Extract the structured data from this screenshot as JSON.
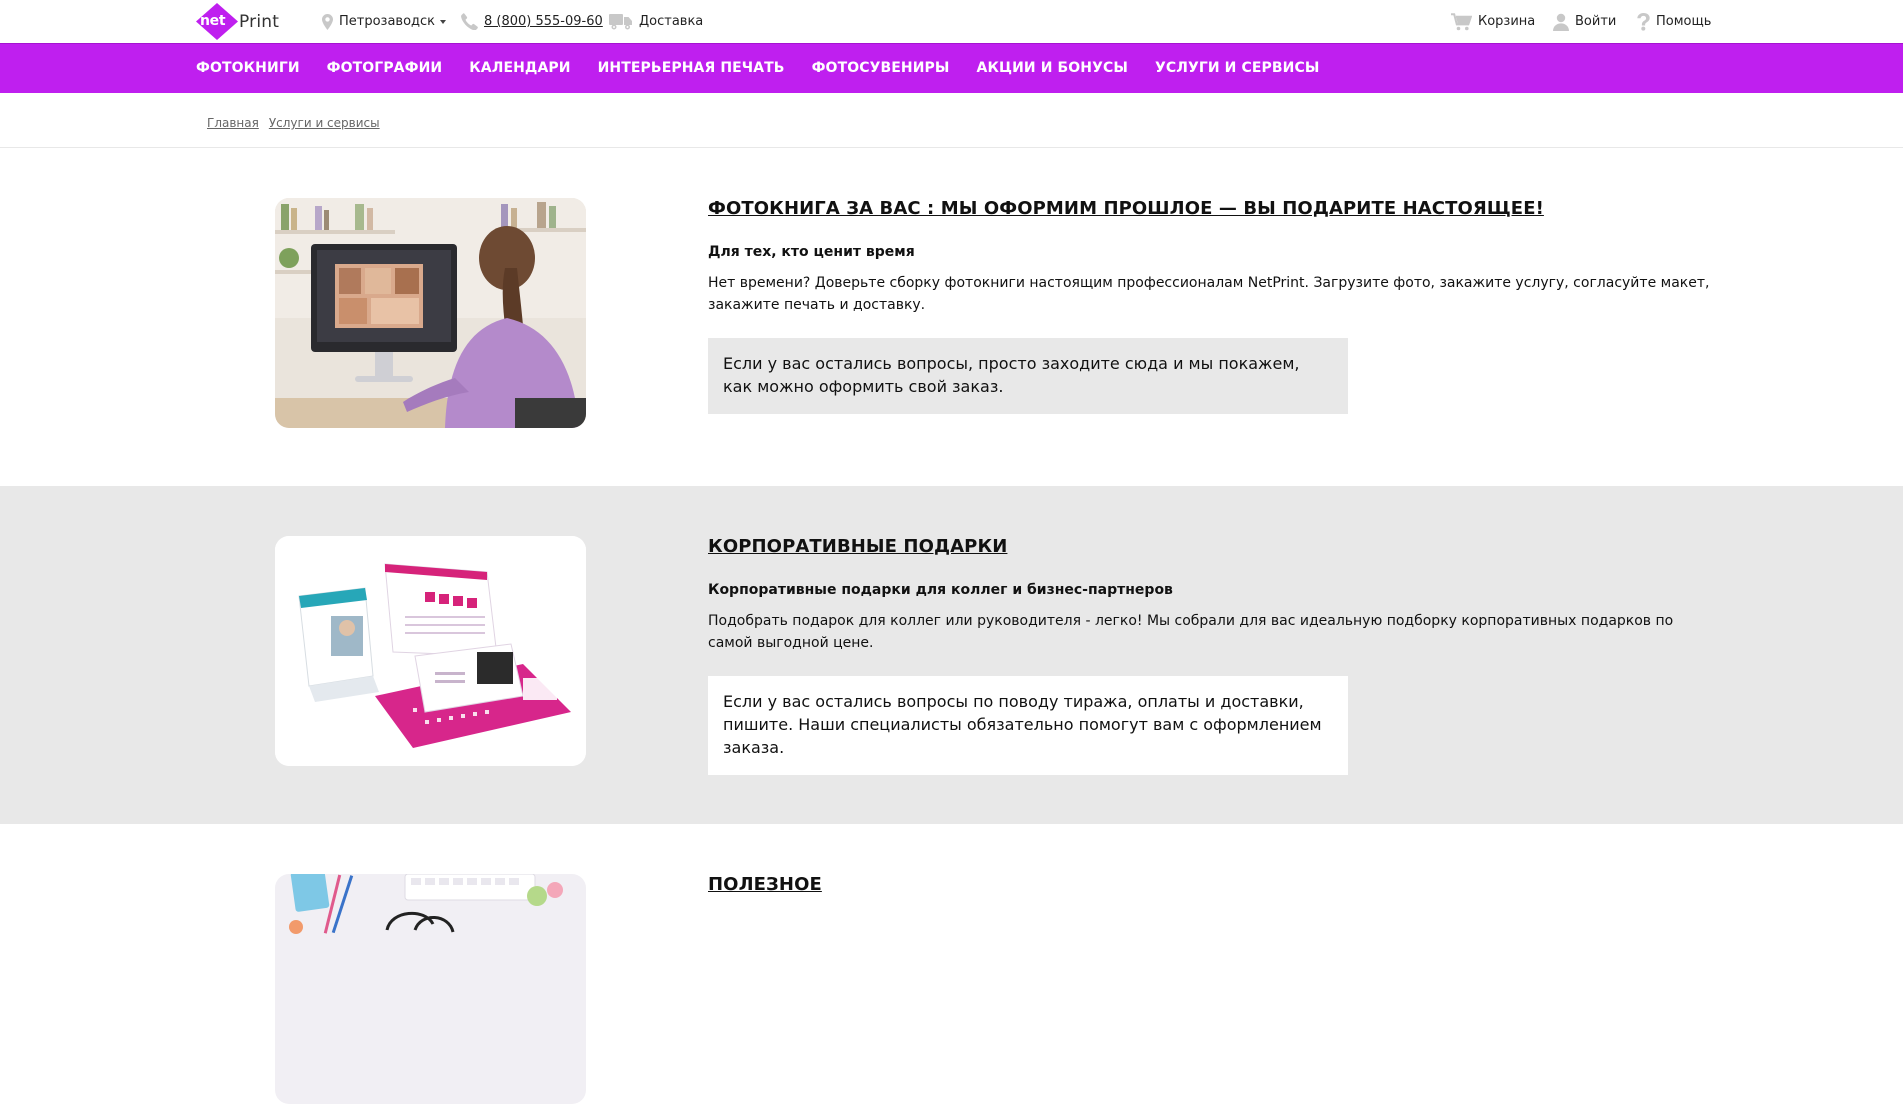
{
  "brand": {
    "logo_mark_text": "net",
    "logo_word": "Print",
    "accent_color": "#bf1fef"
  },
  "topbar": {
    "city": {
      "icon": "map-pin-icon",
      "label": "Петрозаводск"
    },
    "phone": {
      "icon": "phone-icon",
      "label": "8 (800) 555-09-60"
    },
    "delivery": {
      "icon": "truck-icon",
      "label": "Доставка"
    },
    "cart": {
      "icon": "cart-icon",
      "label": "Корзина"
    },
    "login": {
      "icon": "user-icon",
      "label": "Войти"
    },
    "help": {
      "icon": "question-icon",
      "label": "Помощь"
    }
  },
  "nav": {
    "items": [
      {
        "label": "ФОТОКНИГИ"
      },
      {
        "label": "ФОТОГРАФИИ"
      },
      {
        "label": "КАЛЕНДАРИ"
      },
      {
        "label": "ИНТЕРЬЕРНАЯ ПЕЧАТЬ"
      },
      {
        "label": "ФОТОСУВЕНИРЫ"
      },
      {
        "label": "АКЦИИ И БОНУСЫ"
      },
      {
        "label": "УСЛУГИ И СЕРВИСЫ"
      }
    ]
  },
  "breadcrumb": [
    {
      "label": "Главная"
    },
    {
      "label": "Услуги и сервисы"
    }
  ],
  "services": [
    {
      "title": "ФОТОКНИГА ЗА ВАС : МЫ ОФОРМИМ ПРОШЛОЕ — ВЫ ПОДАРИТЕ НАСТОЯЩЕЕ!",
      "subtitle": "Для тех, кто ценит время",
      "description": "Нет времени? Доверьте сборку фотокниги настоящим профессионалам NetPrint. Загрузите фото, закажите услугу, согласуйте макет, закажите печать и доставку.",
      "note": "Если у вас остались вопросы, просто заходите сюда и мы покажем, как можно оформить свой заказ.",
      "image": "woman-designing-photobook-image"
    },
    {
      "title": "КОРПОРАТИВНЫЕ ПОДАРКИ",
      "subtitle": "Корпоративные подарки для коллег и бизнес-партнеров",
      "description": "Подобрать подарок для коллег или руководителя - легко! Мы собрали для вас идеальную подборку корпоративных подарков по самой выгодной цене.",
      "note": "Если у вас остались вопросы по поводу тиража, оплаты и доставки, пишите. Наши специалисты обязательно помогут вам с оформлением заказа.",
      "image": "desk-calendars-image"
    },
    {
      "title": "ПОЛЕЗНОЕ",
      "image": "desk-stationery-image"
    }
  ]
}
